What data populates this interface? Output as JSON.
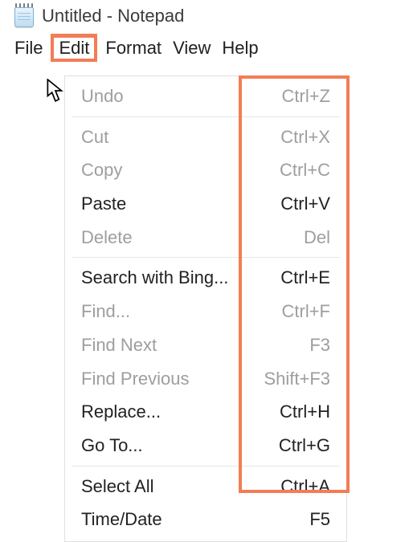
{
  "window": {
    "title": "Untitled - Notepad"
  },
  "menu": {
    "items": [
      {
        "label": "File"
      },
      {
        "label": "Edit",
        "active": true
      },
      {
        "label": "Format"
      },
      {
        "label": "View"
      },
      {
        "label": "Help"
      }
    ]
  },
  "dropdown": {
    "groups": [
      [
        {
          "label": "Undo",
          "shortcut": "Ctrl+Z",
          "enabled": false
        }
      ],
      [
        {
          "label": "Cut",
          "shortcut": "Ctrl+X",
          "enabled": false
        },
        {
          "label": "Copy",
          "shortcut": "Ctrl+C",
          "enabled": false
        },
        {
          "label": "Paste",
          "shortcut": "Ctrl+V",
          "enabled": true
        },
        {
          "label": "Delete",
          "shortcut": "Del",
          "enabled": false
        }
      ],
      [
        {
          "label": "Search with Bing...",
          "shortcut": "Ctrl+E",
          "enabled": true
        },
        {
          "label": "Find...",
          "shortcut": "Ctrl+F",
          "enabled": false
        },
        {
          "label": "Find Next",
          "shortcut": "F3",
          "enabled": false
        },
        {
          "label": "Find Previous",
          "shortcut": "Shift+F3",
          "enabled": false
        },
        {
          "label": "Replace...",
          "shortcut": "Ctrl+H",
          "enabled": true
        },
        {
          "label": "Go To...",
          "shortcut": "Ctrl+G",
          "enabled": true
        }
      ],
      [
        {
          "label": "Select All",
          "shortcut": "Ctrl+A",
          "enabled": true
        },
        {
          "label": "Time/Date",
          "shortcut": "F5",
          "enabled": true
        }
      ]
    ]
  },
  "highlight": {
    "color": "#f47c55"
  }
}
